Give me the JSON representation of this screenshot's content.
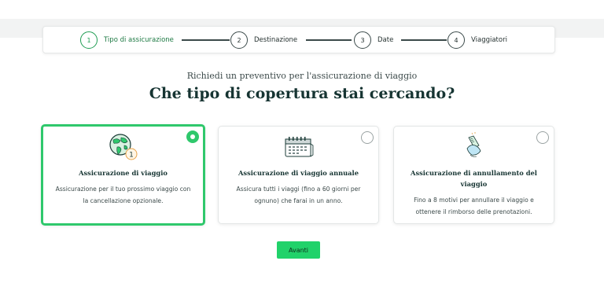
{
  "stepper": {
    "steps": [
      {
        "number": "1",
        "label": "Tipo di assicurazione",
        "active": true
      },
      {
        "number": "2",
        "label": "Destinazione",
        "active": false
      },
      {
        "number": "3",
        "label": "Date",
        "active": false
      },
      {
        "number": "4",
        "label": "Viaggiatori",
        "active": false
      }
    ]
  },
  "header": {
    "subtitle": "Richiedi un preventivo per l'assicurazione di viaggio",
    "title": "Che tipo di copertura stai cercando?"
  },
  "options": [
    {
      "title": "Assicurazione di viaggio",
      "description": "Assicurazione per il tuo prossimo viaggio con la cancellazione opzionale.",
      "icon": "globe-icon",
      "selected": true
    },
    {
      "title": "Assicurazione di viaggio annuale",
      "description": "Assicura tutti i viaggi (fino a 60 giorni per ognuno) che farai in un anno.",
      "icon": "calendar-icon",
      "selected": false
    },
    {
      "title": "Assicurazione di annullamento del viaggio",
      "description": "Fino a 8 motivi per annullare il viaggio e ottenere il rimborso delle prenotazioni.",
      "icon": "cancel-hand-icon",
      "selected": false
    }
  ],
  "cta": {
    "label": "Avanti"
  },
  "colors": {
    "accent": "#2fc86c",
    "button": "#21d26a",
    "dark_text": "#163432"
  }
}
